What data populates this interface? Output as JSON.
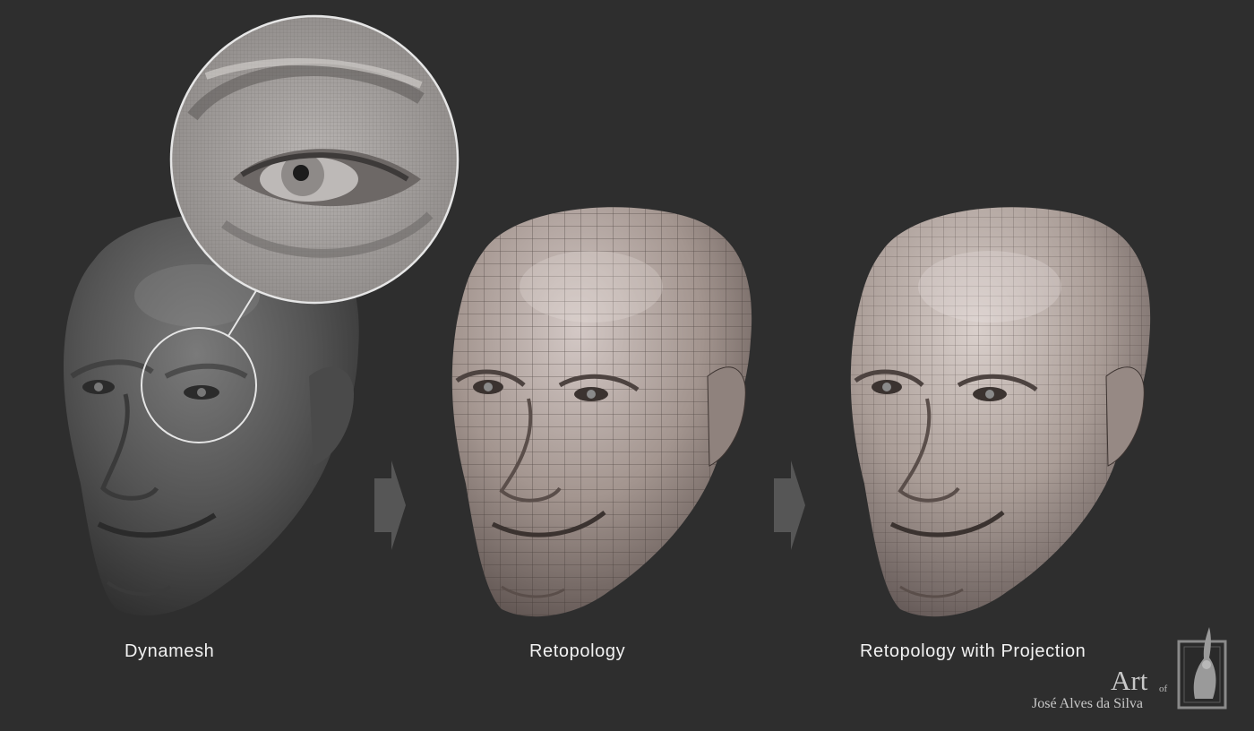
{
  "captions": {
    "dynamesh": "Dynamesh",
    "retopology": "Retopology",
    "retopology_projection": "Retopology with Projection"
  },
  "signature": {
    "art": "Art",
    "of": "of",
    "name": "José Alves da Silva"
  },
  "colors": {
    "background": "#2e2e2e",
    "dynamesh_head": "#5a5a5a",
    "retopo_head": "#a99c98",
    "projection_head": "#b0a49f",
    "wire": "#3a3232",
    "arrow": "#555555",
    "caption": "#f2f2f2"
  },
  "icons": [
    "right-arrow-icon",
    "right-arrow-icon",
    "magnifier-callout",
    "rabbit-frame-logo"
  ]
}
